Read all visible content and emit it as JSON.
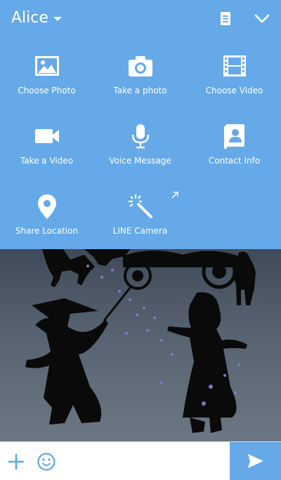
{
  "colors": {
    "panel": "#65a9e9",
    "icon": "#ffffff",
    "input_icons": "#5ba8ec",
    "send_button": "#65a9e9"
  },
  "header": {
    "contact_name": "Alice",
    "icons": [
      "chevron-down-icon",
      "note-icon",
      "collapse-icon"
    ]
  },
  "attachments": [
    {
      "label": "Choose Photo",
      "icon": "image-icon"
    },
    {
      "label": "Take a photo",
      "icon": "camera-icon"
    },
    {
      "label": "Choose Video",
      "icon": "film-icon"
    },
    {
      "label": "Take a Video",
      "icon": "video-camera-icon"
    },
    {
      "label": "Voice Message",
      "icon": "microphone-icon"
    },
    {
      "label": "Contact Info",
      "icon": "contact-card-icon"
    },
    {
      "label": "Share Location",
      "icon": "location-pin-icon"
    },
    {
      "label": "LINE Camera",
      "icon": "magic-wand-icon"
    }
  ],
  "input_bar": {
    "message_value": "",
    "icons": [
      "plus-icon",
      "emoji-icon",
      "send-icon"
    ]
  }
}
